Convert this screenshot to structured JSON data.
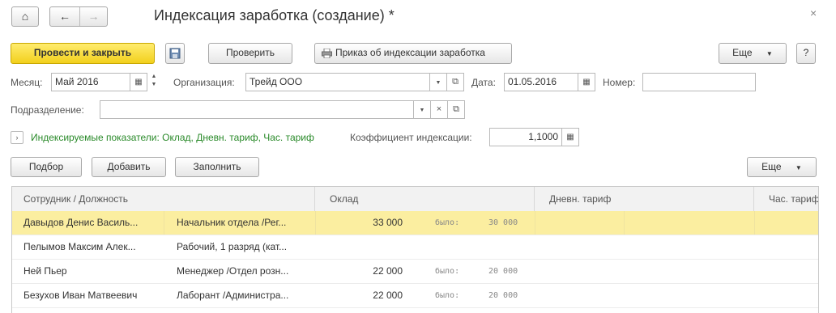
{
  "window": {
    "title": "Индексация заработка (создание) *",
    "close_glyph": "×"
  },
  "toolbar": {
    "home_glyph": "⌂",
    "back_glyph": "←",
    "forward_glyph": "→",
    "post_close_label": "Провести и закрыть",
    "check_label": "Проверить",
    "print_order_label": "Приказ об индексации заработка",
    "more_label": "Еще",
    "help_label": "?"
  },
  "form": {
    "month_label": "Месяц:",
    "month_value": "Май 2016",
    "org_label": "Организация:",
    "org_value": "Трейд ООО",
    "date_label": "Дата:",
    "date_value": "01.05.2016",
    "number_label": "Номер:",
    "number_value": "",
    "dept_label": "Подразделение:",
    "dept_value": "",
    "indexed_link": "Индексируемые показатели: Оклад, Дневн. тариф, Час. тариф",
    "coef_label": "Коэффициент индексации:",
    "coef_value": "1,1000"
  },
  "table_toolbar": {
    "pick_label": "Подбор",
    "add_label": "Добавить",
    "fill_label": "Заполнить",
    "more_label": "Еще"
  },
  "table": {
    "headers": [
      "Сотрудник / Должность",
      "Оклад",
      "Дневн. тариф",
      "Час. тарифы"
    ],
    "rows": [
      {
        "employee": "Давыдов Денис Василь...",
        "position": "Начальник отдела /Рег...",
        "salary": "33 000",
        "was_label": "было:",
        "was_value": "30 000",
        "selected": true
      },
      {
        "employee": "Пелымов Максим Алек...",
        "position": "Рабочий, 1 разряд (кат...",
        "salary": "",
        "was_label": "",
        "was_value": "",
        "selected": false
      },
      {
        "employee": "Ней Пьер",
        "position": "Менеджер /Отдел розн...",
        "salary": "22 000",
        "was_label": "было:",
        "was_value": "20 000",
        "selected": false
      },
      {
        "employee": "Безухов Иван Матвеевич",
        "position": "Лаборант /Администра...",
        "salary": "22 000",
        "was_label": "было:",
        "was_value": "20 000",
        "selected": false
      }
    ]
  }
}
